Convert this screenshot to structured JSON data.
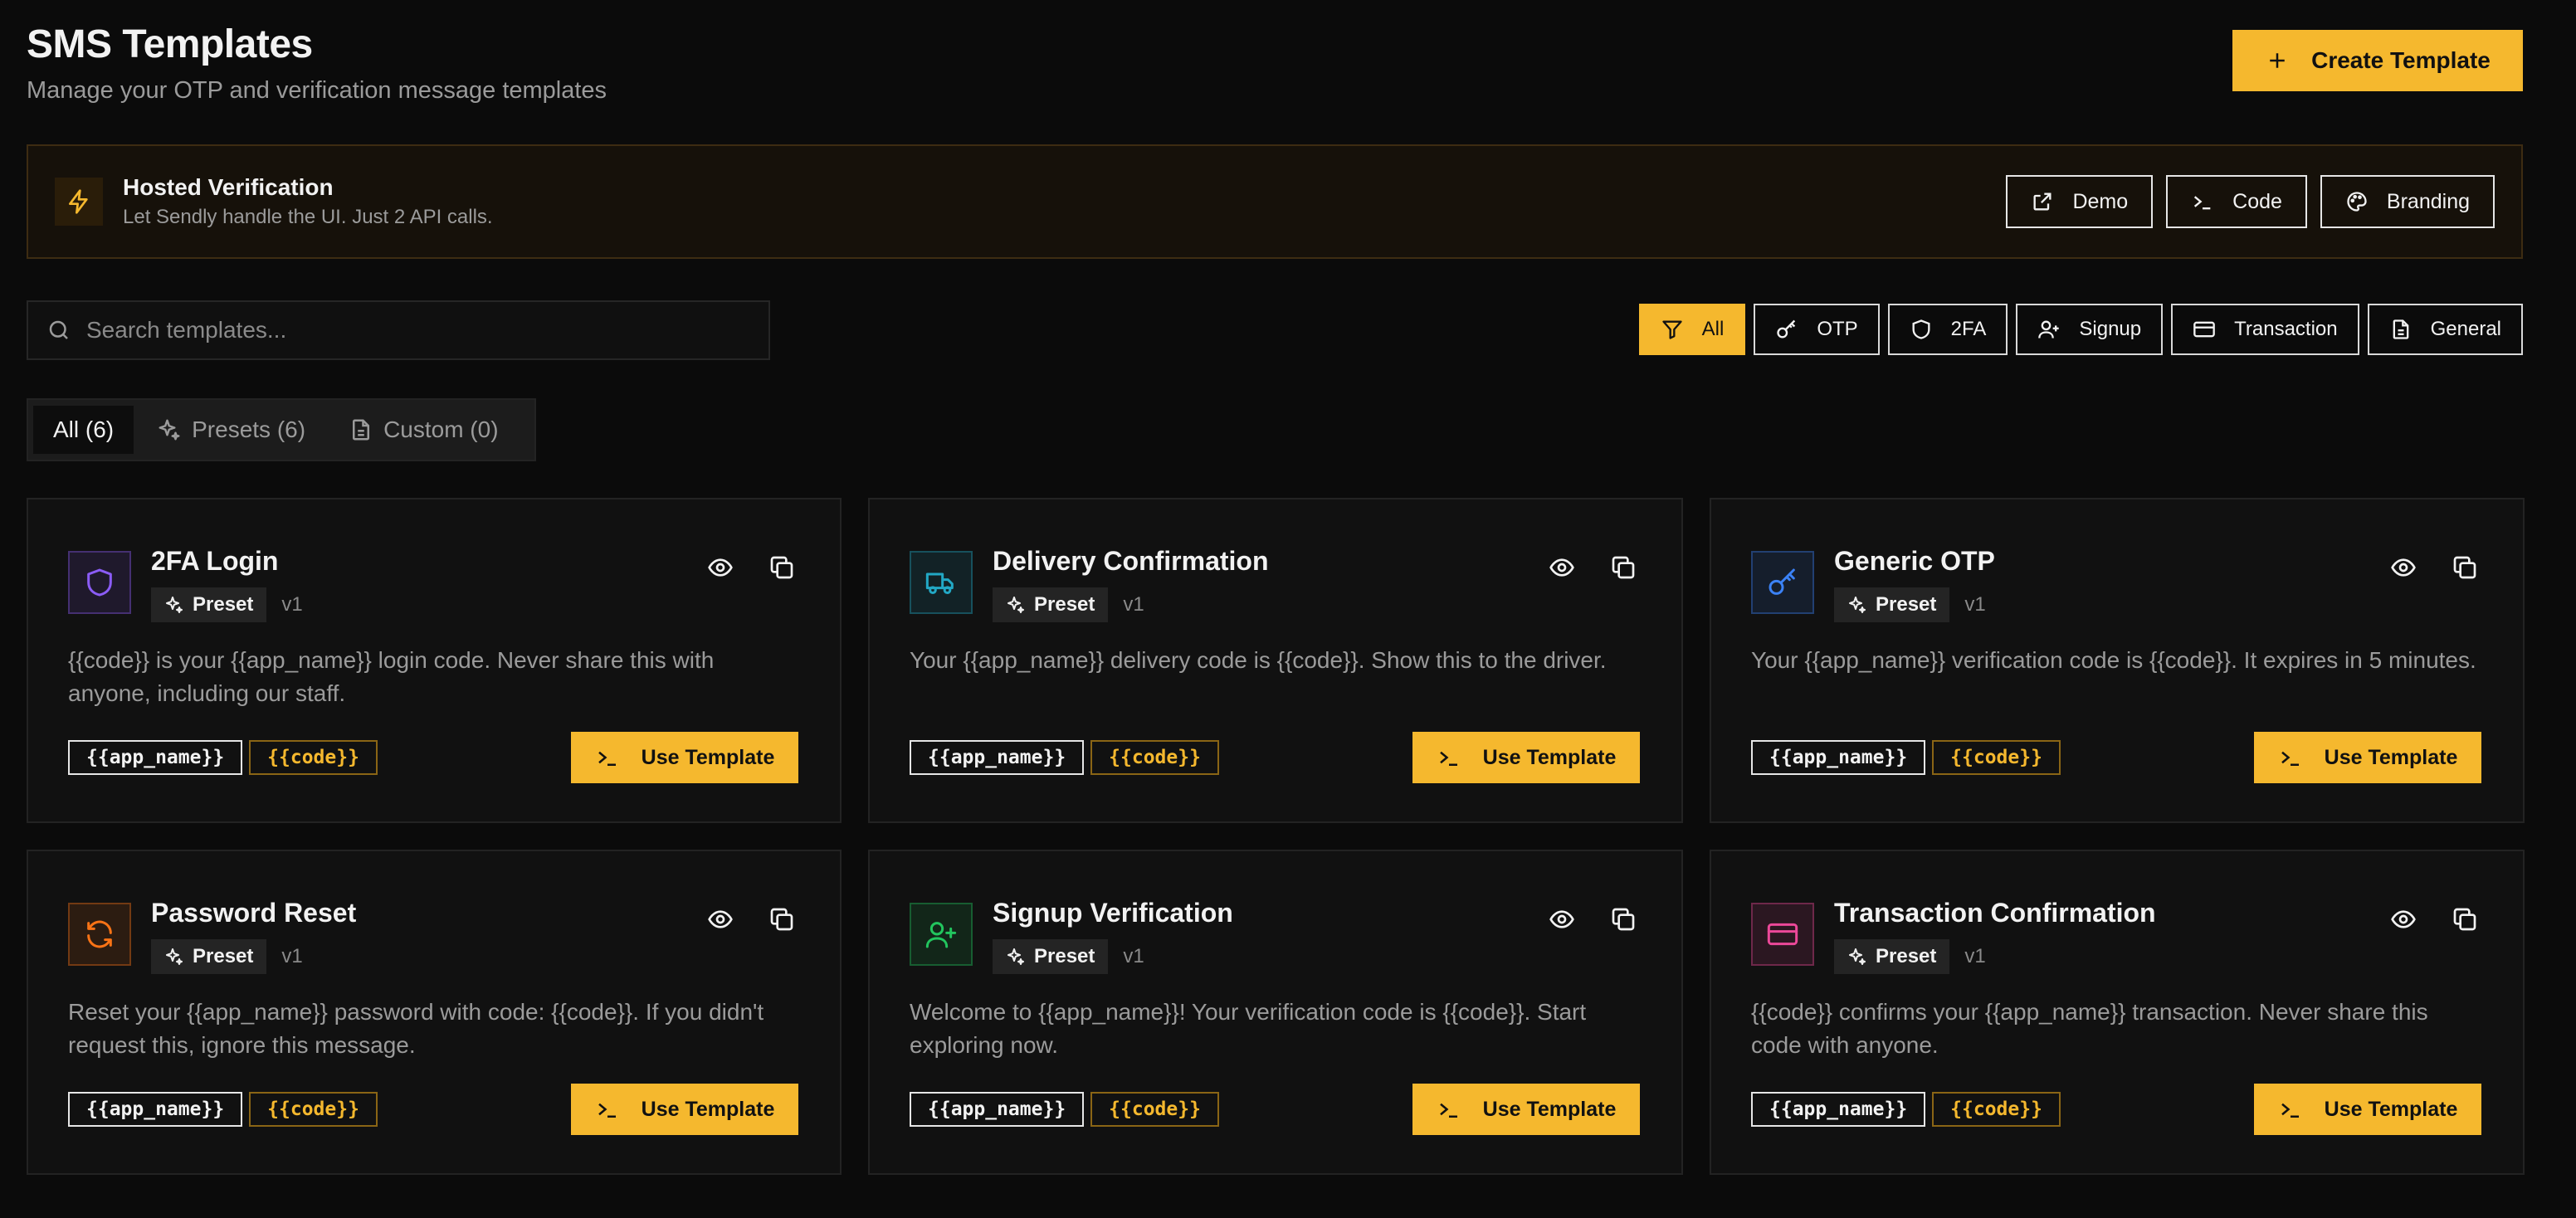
{
  "header": {
    "title": "SMS Templates",
    "subtitle": "Manage your OTP and verification message templates",
    "create_label": "Create Template"
  },
  "banner": {
    "title": "Hosted Verification",
    "subtitle": "Let Sendly handle the UI. Just 2 API calls.",
    "actions": [
      {
        "label": "Demo",
        "icon": "external-link-icon"
      },
      {
        "label": "Code",
        "icon": "terminal-icon"
      },
      {
        "label": "Branding",
        "icon": "palette-icon"
      }
    ]
  },
  "search": {
    "placeholder": "Search templates..."
  },
  "filters": [
    {
      "label": "All",
      "icon": "filter-icon",
      "active": true
    },
    {
      "label": "OTP",
      "icon": "key-icon",
      "active": false
    },
    {
      "label": "2FA",
      "icon": "shield-icon",
      "active": false
    },
    {
      "label": "Signup",
      "icon": "user-plus-icon",
      "active": false
    },
    {
      "label": "Transaction",
      "icon": "credit-card-icon",
      "active": false
    },
    {
      "label": "General",
      "icon": "file-text-icon",
      "active": false
    }
  ],
  "tabs": [
    {
      "label": "All (6)",
      "active": true
    },
    {
      "label": "Presets (6)",
      "icon": "sparkles-icon",
      "active": false
    },
    {
      "label": "Custom (0)",
      "icon": "file-icon",
      "active": false
    }
  ],
  "badge_label": "Preset",
  "use_label": "Use  Template",
  "colors": {
    "accent": "#f5b82e",
    "background": "#0b0b0b",
    "card": "#111111"
  },
  "cards": [
    {
      "name": "2FA Login",
      "icon": "shield-icon",
      "color": "#8b5cf6",
      "version": "v1",
      "body": "{{code}} is your {{app_name}} login code. Never share this with anyone, including our staff.",
      "vars": [
        "{{app_name}}",
        "{{code}}"
      ]
    },
    {
      "name": "Delivery Confirmation",
      "icon": "truck-icon",
      "color": "#22a8c5",
      "version": "v1",
      "body": "Your {{app_name}} delivery code is {{code}}. Show this to the driver.",
      "vars": [
        "{{app_name}}",
        "{{code}}"
      ]
    },
    {
      "name": "Generic OTP",
      "icon": "key-icon",
      "color": "#3b82f6",
      "version": "v1",
      "body": "Your {{app_name}} verification code is {{code}}. It expires in 5 minutes.",
      "vars": [
        "{{app_name}}",
        "{{code}}"
      ]
    },
    {
      "name": "Password Reset",
      "icon": "refresh-icon",
      "color": "#f97316",
      "version": "v1",
      "body": "Reset your {{app_name}} password with code: {{code}}. If you didn't request this, ignore this message.",
      "vars": [
        "{{app_name}}",
        "{{code}}"
      ]
    },
    {
      "name": "Signup Verification",
      "icon": "user-plus-icon",
      "color": "#22c55e",
      "version": "v1",
      "body": "Welcome to {{app_name}}! Your verification code is {{code}}. Start exploring now.",
      "vars": [
        "{{app_name}}",
        "{{code}}"
      ]
    },
    {
      "name": "Transaction Confirmation",
      "icon": "credit-card-icon",
      "color": "#ec4899",
      "version": "v1",
      "body": "{{code}} confirms your {{app_name}} transaction. Never share this code with anyone.",
      "vars": [
        "{{app_name}}",
        "{{code}}"
      ]
    }
  ]
}
